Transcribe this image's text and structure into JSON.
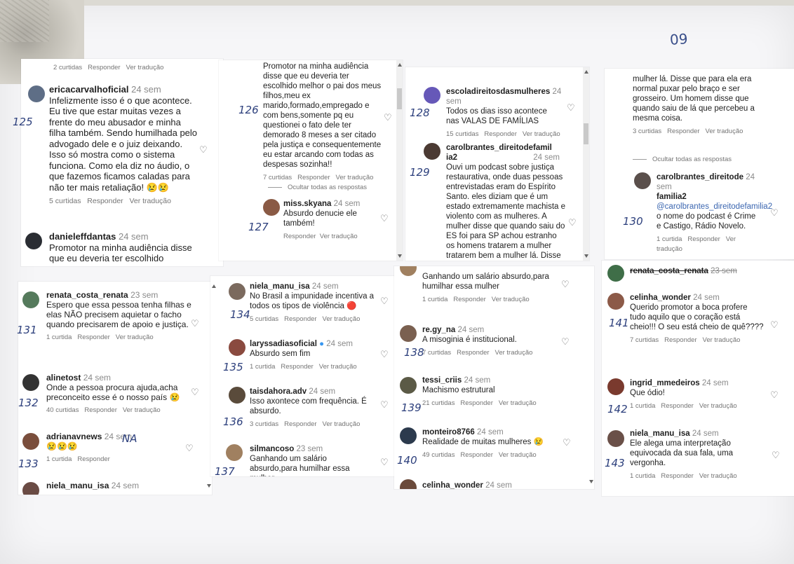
{
  "page_number": "09",
  "ui": {
    "reply": "Responder",
    "translate": "Ver tradução",
    "hide_replies": "Ocultar todas as respostas"
  },
  "s1": {
    "top_likes": "2 curtidas",
    "c125": {
      "user": "ericacarvalhoficial",
      "time": "24 sem",
      "text": "Infelizmente isso é o que acontece. Eu tive que estar muitas vezes a frente do meu abusador e minha filha também. Sendo humilhada pelo advogado dele e o juiz deixando. Isso só mostra como o sistema funciona. Como ela diz no áudio, o que fazemos ficamos caladas para não ter mais retaliação! 😢😢",
      "likes": "5 curtidas",
      "mark": "125"
    },
    "c126": {
      "user": "danieleffdantas",
      "time": "24 sem",
      "text": "Promotor na minha audiência disse que eu deveria ter escolhido"
    }
  },
  "s2": {
    "c126": {
      "text": "Promotor na minha audiência disse que eu deveria ter escolhido melhor o pai dos meus filhos,meu ex marido,formado,empregado e com bens,somente pq eu questionei o fato dele ter demorado 8 meses a ser citado pela justiça e consequentemente eu estar arcando com todas as despesas sozinha!!",
      "likes": "7 curtidas",
      "mark": "126"
    },
    "c127": {
      "user": "miss.skyana",
      "time": "24 sem",
      "text": "Absurdo denucie ele também!",
      "mark": "127"
    }
  },
  "s3": {
    "c128": {
      "user": "escoladireitosdasmulheres",
      "time": "24 sem",
      "text": "Todos os dias isso acontece nas VALAS DE FAMÍLIAS",
      "likes": "15 curtidas",
      "mark": "128"
    },
    "c129": {
      "user": "carolbrantes_direitodefamil",
      "user2": "ia2",
      "time": "24 sem",
      "text": "Ouvi um podcast sobre justiça restaurativa, onde duas pessoas entrevistadas eram do Espírito Santo. eles diziam que é um estado extremamente machista e violento com as mulheres. A mulher disse que quando saiu do ES foi para SP achou estranho os homens tratarem a mulher tratarem bem a mulher lá. Disse que para ela era normal puxar pelo braço e ser",
      "mark": "129"
    }
  },
  "s4": {
    "top_text": "mulher lá. Disse que para ela era normal puxar pelo braço e ser grosseiro. Um homem disse que quando saiu de lá que percebeu a mesma coisa.",
    "top_likes": "3 curtidas",
    "c130": {
      "user": "carolbrantes_direitode",
      "user2": "familia2",
      "time": "24 sem",
      "mention": "@carolbrantes_direitodefamilia2",
      "text": "o nome do podcast é Crime e Castigo, Rádio Novelo.",
      "likes": "1 curtida",
      "mark": "130"
    }
  },
  "s5": {
    "c131": {
      "user": "renata_costa_renata",
      "time": "23 sem",
      "text": "Espero que essa pessoa tenha filhas e elas NÃO precisem aquietar o facho quando precisarem de apoio e justiça.",
      "likes": "1 curtida",
      "mark": "131"
    },
    "c132": {
      "user": "alinetost",
      "time": "24 sem",
      "text": "Onde a pessoa procura ajuda,acha preconceito esse é o nosso país 😢",
      "likes": "40 curtidas",
      "mark": "132"
    },
    "c133": {
      "user": "adrianavnews",
      "time": "24 sem",
      "text": "😢😢😢",
      "likes": "1 curtida",
      "mark": "133",
      "mark2": "NA"
    },
    "c134a": {
      "user": "niela_manu_isa",
      "time": "24 sem"
    }
  },
  "s6": {
    "c134": {
      "user": "niela_manu_isa",
      "time": "24 sem",
      "text": "No Brasil a impunidade incentiva a todos os tipos de violência 🔴",
      "likes": "5 curtidas",
      "mark": "134"
    },
    "c135": {
      "user": "laryssadiasoficial",
      "time": "24 sem",
      "text": "Absurdo sem fim",
      "likes": "1 curtida",
      "mark": "135"
    },
    "c136": {
      "user": "taisdahora.adv",
      "time": "24 sem",
      "text": "Isso axontece com frequência. É absurdo.",
      "likes": "3 curtidas",
      "mark": "136"
    },
    "c137": {
      "user": "silmancoso",
      "time": "23 sem",
      "text": "Ganhando um salário absurdo,para humilhar essa mulher",
      "mark": "137"
    }
  },
  "s7": {
    "top_text": "Ganhando um salário absurdo,para humilhar essa mulher",
    "top_likes": "1 curtida",
    "c138": {
      "user": "re.gy_na",
      "time": "24 sem",
      "text": "A misoginia é institucional.",
      "likes": "7 curtidas",
      "mark": "138"
    },
    "c139": {
      "user": "tessi_criis",
      "time": "24 sem",
      "text": "Machismo estrutural",
      "likes": "21 curtidas",
      "mark": "139"
    },
    "c140": {
      "user": "monteiro8766",
      "time": "24 sem",
      "text": "Realidade de muitas mulheres 😢",
      "likes": "49 curtidas",
      "mark": "140"
    },
    "c140b": {
      "user": "celinha_wonder",
      "time": "24 sem"
    }
  },
  "s8": {
    "c140a": {
      "user": "renata_costa_renata",
      "time": "23 sem"
    },
    "c141": {
      "user": "celinha_wonder",
      "time": "24 sem",
      "text": "Querido promotor a boca profere tudo aquilo que o coração está cheio!!! O seu está cheio de quê????",
      "likes": "7 curtidas",
      "mark": "141"
    },
    "c142": {
      "user": "ingrid_mmedeiros",
      "time": "24 sem",
      "text": "Que ódio!",
      "likes": "1 curtida",
      "mark": "142"
    },
    "c143": {
      "user": "niela_manu_isa",
      "time": "24 sem",
      "text": "Ele alega uma interpretação equivocada da sua fala, uma vergonha.",
      "likes": "1 curtida",
      "mark": "143"
    }
  }
}
